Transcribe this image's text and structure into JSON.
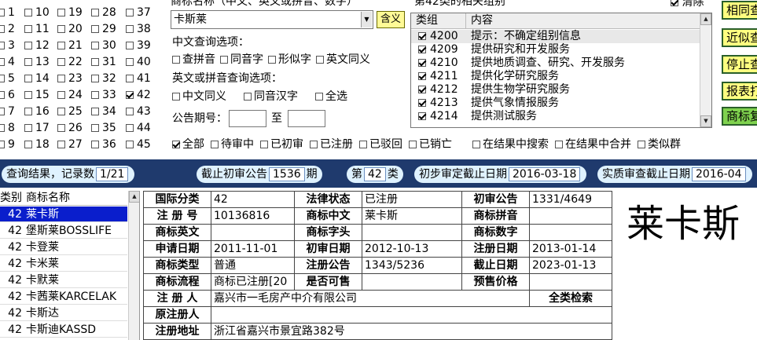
{
  "class_grid": {
    "rows": [
      [
        {
          "n": "1",
          "on": false
        },
        {
          "n": "10",
          "on": false
        },
        {
          "n": "19",
          "on": false
        },
        {
          "n": "28",
          "on": false
        },
        {
          "n": "37",
          "on": false
        }
      ],
      [
        {
          "n": "2",
          "on": false
        },
        {
          "n": "11",
          "on": false
        },
        {
          "n": "20",
          "on": false
        },
        {
          "n": "29",
          "on": false
        },
        {
          "n": "38",
          "on": false
        }
      ],
      [
        {
          "n": "3",
          "on": false
        },
        {
          "n": "12",
          "on": false
        },
        {
          "n": "21",
          "on": false
        },
        {
          "n": "30",
          "on": false
        },
        {
          "n": "39",
          "on": false
        }
      ],
      [
        {
          "n": "4",
          "on": false
        },
        {
          "n": "13",
          "on": false
        },
        {
          "n": "22",
          "on": false
        },
        {
          "n": "31",
          "on": false
        },
        {
          "n": "40",
          "on": false
        }
      ],
      [
        {
          "n": "5",
          "on": false
        },
        {
          "n": "14",
          "on": false
        },
        {
          "n": "23",
          "on": false
        },
        {
          "n": "32",
          "on": false
        },
        {
          "n": "41",
          "on": false
        }
      ],
      [
        {
          "n": "6",
          "on": false
        },
        {
          "n": "15",
          "on": false
        },
        {
          "n": "24",
          "on": false
        },
        {
          "n": "33",
          "on": false
        },
        {
          "n": "42",
          "on": true
        }
      ],
      [
        {
          "n": "7",
          "on": false
        },
        {
          "n": "16",
          "on": false
        },
        {
          "n": "25",
          "on": false
        },
        {
          "n": "34",
          "on": false
        },
        {
          "n": "43",
          "on": false
        }
      ],
      [
        {
          "n": "8",
          "on": false
        },
        {
          "n": "17",
          "on": false
        },
        {
          "n": "26",
          "on": false
        },
        {
          "n": "35",
          "on": false
        },
        {
          "n": "44",
          "on": false
        }
      ],
      [
        {
          "n": "9",
          "on": false
        },
        {
          "n": "18",
          "on": false
        },
        {
          "n": "27",
          "on": false
        },
        {
          "n": "36",
          "on": false
        },
        {
          "n": "45",
          "on": false
        }
      ]
    ]
  },
  "search": {
    "name_label": "商标名称（中文、英文或拼音、数字）",
    "name_value": "卡斯莱",
    "hanyi_label": "含义",
    "cn_opts_label": "中文查询选项：",
    "cn_opts": [
      {
        "label": "查拼音",
        "on": false
      },
      {
        "label": "同音字",
        "on": false
      },
      {
        "label": "形似字",
        "on": false
      },
      {
        "label": "英文同义",
        "on": false
      }
    ],
    "en_opts_label": "英文或拼音查询选项：",
    "en_opts": [
      {
        "label": "中文同义",
        "on": false
      },
      {
        "label": "同音汉字",
        "on": false
      },
      {
        "label": "全选",
        "on": false
      }
    ],
    "period_label": "公告期号：",
    "period_to": "至",
    "period_from_value": "",
    "period_to_value": ""
  },
  "groups": {
    "title": "第42类的相关组别",
    "clear_label": "清除",
    "clear_on": true,
    "col_group": "类组",
    "col_content": "内容",
    "rows": [
      {
        "code": "4200",
        "desc": "提示：不确定组别信息",
        "on": true
      },
      {
        "code": "4209",
        "desc": "提供研究和开发服务",
        "on": true
      },
      {
        "code": "4210",
        "desc": "提供地质调查、研究、开发服务",
        "on": true
      },
      {
        "code": "4211",
        "desc": "提供化学研究服务",
        "on": true
      },
      {
        "code": "4212",
        "desc": "提供生物学研究服务",
        "on": true
      },
      {
        "code": "4213",
        "desc": "提供气象情报服务",
        "on": true
      },
      {
        "code": "4214",
        "desc": "提供测试服务",
        "on": true
      }
    ]
  },
  "right_buttons": [
    {
      "label": "相同查",
      "style": "y"
    },
    {
      "label": "近似查",
      "style": "y"
    },
    {
      "label": "停止查",
      "style": "y"
    },
    {
      "label": "报表打",
      "style": "y"
    },
    {
      "label": "商标复",
      "style": "g"
    }
  ],
  "filters": [
    {
      "label": "全部",
      "on": true
    },
    {
      "label": "待审中",
      "on": false
    },
    {
      "label": "已初审",
      "on": false
    },
    {
      "label": "已注册",
      "on": false
    },
    {
      "label": "已驳回",
      "on": false
    },
    {
      "label": "已销亡",
      "on": false
    },
    {
      "label": "在结果中搜索",
      "on": false
    },
    {
      "label": "在结果中合并",
      "on": false
    },
    {
      "label": "类似群",
      "on": false
    }
  ],
  "status": {
    "result_label": "查询结果，记录数",
    "result_value": "1/21",
    "cutoff_label": "截止初审公告",
    "cutoff_value": "1536",
    "cutoff_unit": "期",
    "class_prefix": "第",
    "class_value": "42",
    "class_suffix": "类",
    "prelim_label": "初步审定截止日期",
    "prelim_value": "2016-03-18",
    "subst_label": "实质审查截止日期",
    "subst_value": "2016-04"
  },
  "results": {
    "col_class": "类别",
    "col_name": "商标名称",
    "rows": [
      {
        "cls": "42",
        "name": "莱卡斯",
        "sel": true
      },
      {
        "cls": "42",
        "name": "堡斯莱BOSSLIFE",
        "sel": false
      },
      {
        "cls": "42",
        "name": "卡登莱",
        "sel": false
      },
      {
        "cls": "42",
        "name": "卡米莱",
        "sel": false
      },
      {
        "cls": "42",
        "name": "卡默莱",
        "sel": false
      },
      {
        "cls": "42",
        "name": "卡茜莱KARCELAK",
        "sel": false
      },
      {
        "cls": "42",
        "name": "卡斯达",
        "sel": false
      },
      {
        "cls": "42",
        "name": "卡斯迪KASSD",
        "sel": false
      }
    ]
  },
  "detail": {
    "intl_class_k": "国际分类",
    "intl_class_v": "42",
    "legal_status_k": "法律状态",
    "legal_status_v": "已注册",
    "prelim_pub_k": "初审公告",
    "prelim_pub_v": "1331/4649",
    "reg_no_k": "注 册 号",
    "reg_no_v": "10136816",
    "cn_name_k": "商标中文",
    "cn_name_v": "莱卡斯",
    "pinyin_k": "商标拼音",
    "pinyin_v": "",
    "en_name_k": "商标英文",
    "en_name_v": "",
    "letters_k": "商标字头",
    "letters_v": "",
    "digits_k": "商标数字",
    "digits_v": "",
    "apply_date_k": "申请日期",
    "apply_date_v": "2011-11-01",
    "prelim_date_k": "初审日期",
    "prelim_date_v": "2012-10-13",
    "reg_date_k": "注册日期",
    "reg_date_v": "2013-01-14",
    "type_k": "商标类型",
    "type_v": "普通",
    "reg_pub_k": "注册公告",
    "reg_pub_v": "1343/5236",
    "expiry_k": "截止日期",
    "expiry_v": "2023-01-13",
    "flow_k": "商标流程",
    "flow_v": "商标已注册[20",
    "shared_k": "是否可售",
    "shared_v": "",
    "price_k": "预售价格",
    "price_v": "",
    "registrant_k": "注 册 人",
    "registrant_v": "嘉兴市一毛房产中介有限公司",
    "full_search": "全类检索",
    "orig_registrant_k": "原注册人",
    "orig_registrant_v": "",
    "address_k": "注册地址",
    "address_v": "浙江省嘉兴市景宜路382号"
  },
  "big_name": "莱卡斯"
}
